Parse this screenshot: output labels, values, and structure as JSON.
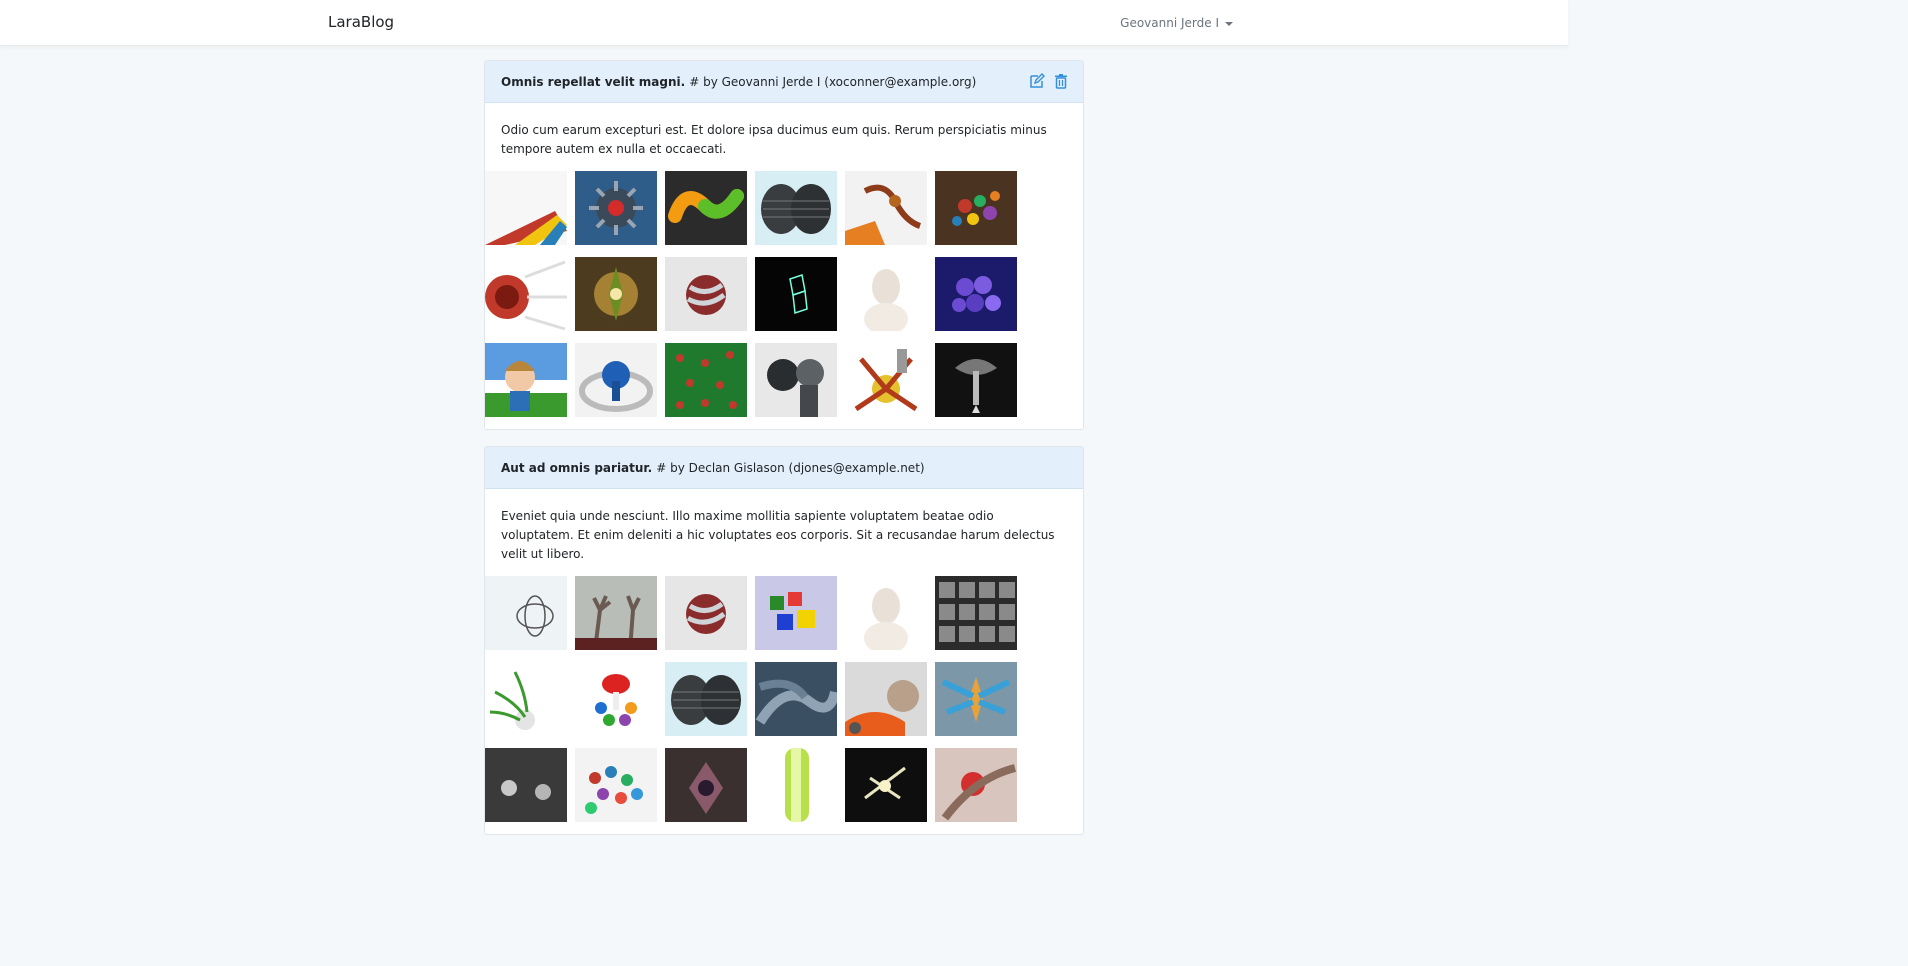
{
  "navbar": {
    "brand": "LaraBlog",
    "user": "Geovanni Jerde I"
  },
  "posts": [
    {
      "title": "Omnis repellat velit magni.",
      "meta": "# by Geovanni Jerde I (xoconner@example.org)",
      "body": "Odio cum earum excepturi est. Et dolore ipsa ducimus eum quis. Rerum perspiciatis minus tempore autem ex nulla et occaecati.",
      "accent": "#3490dc"
    },
    {
      "title": "Aut ad omnis pariatur.",
      "meta": "# by Declan Gislason (djones@example.net)",
      "body": "Eveniet quia unde nesciunt. Illo maxime mollitia sapiente voluptatem beatae odio voluptatem. Et enim deleniti a hic voluptates eos corporis. Sit a recusandae harum delectus velit ut libero."
    }
  ],
  "icons": {
    "edit": "edit-icon",
    "delete": "trash-icon"
  }
}
